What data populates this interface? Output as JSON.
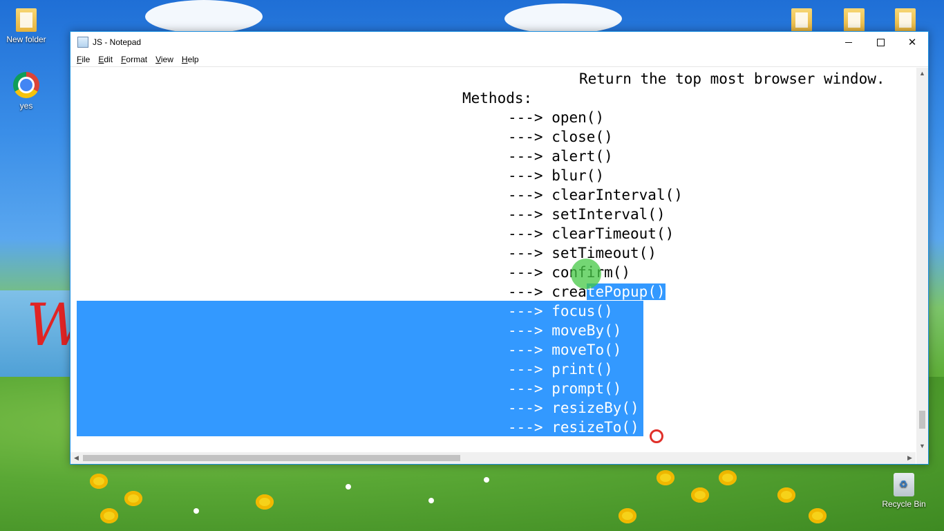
{
  "desktop": {
    "icons": [
      {
        "label": "New folder",
        "icon": "folder-icon"
      },
      {
        "label": "yes",
        "icon": "chrome-icon"
      },
      {
        "label": "Recycle Bin",
        "icon": "recycle-bin-icon"
      }
    ]
  },
  "window": {
    "title": "JS - Notepad",
    "controls": {
      "minimize": "–",
      "maximize": "□",
      "close": "✕"
    }
  },
  "menu": [
    {
      "label": "File",
      "underline": "F",
      "rest": "ile"
    },
    {
      "label": "Edit",
      "underline": "E",
      "rest": "dit"
    },
    {
      "label": "Format",
      "underline": "F",
      "rest": "ormat"
    },
    {
      "label": "View",
      "underline": "V",
      "rest": "iew"
    },
    {
      "label": "Help",
      "underline": "H",
      "rest": "elp"
    }
  ],
  "editor": {
    "header_line": "Return the top most browser window.",
    "methods_heading": "Methods:",
    "arrow": "--->",
    "methods": [
      "open()",
      "close()",
      "alert()",
      "blur()",
      "clearInterval()",
      "setInterval()",
      "clearTimeout()",
      "setTimeout()",
      "confirm()",
      "createPopup()",
      "focus()",
      "moveBy()",
      "moveTo()",
      "print()",
      "prompt()",
      "resizeBy()",
      "resizeTo()"
    ],
    "partial_selection": {
      "unselected": "crea",
      "selected": "tePopup()"
    }
  }
}
